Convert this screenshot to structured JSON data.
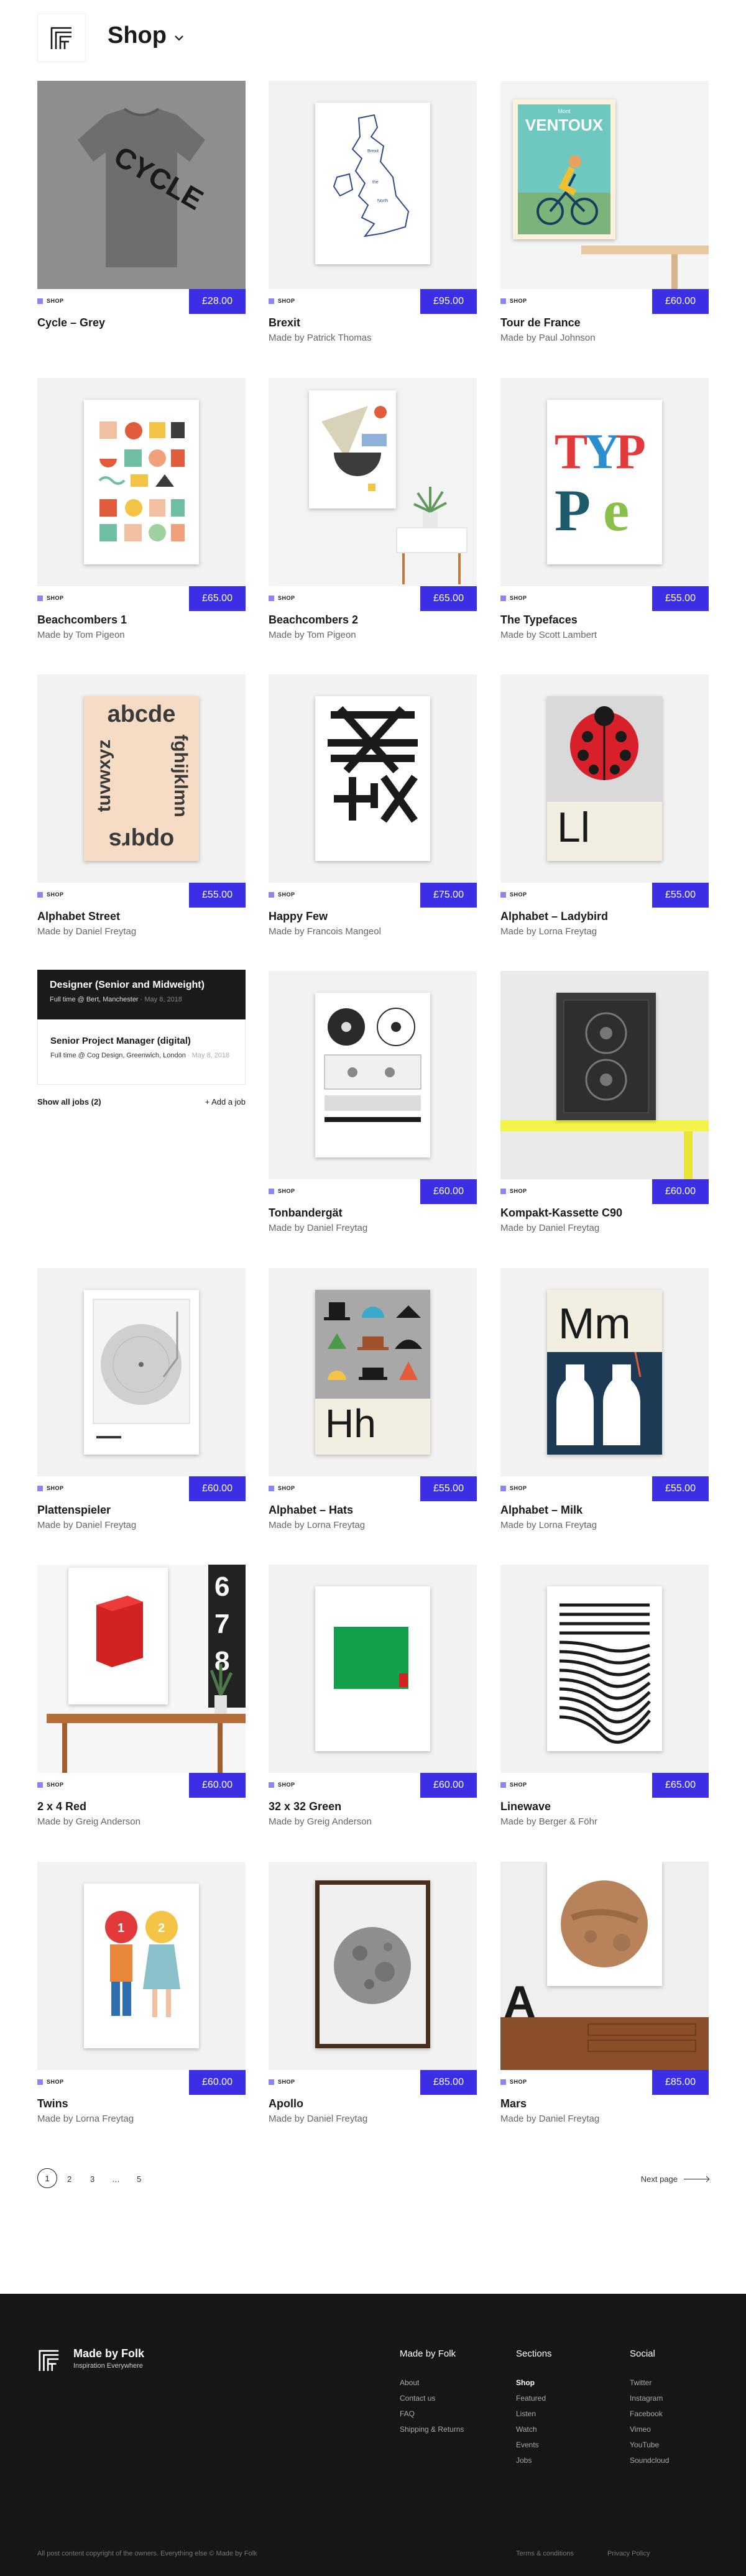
{
  "header": {
    "title": "Shop"
  },
  "products": [
    {
      "tag": "SHOP",
      "price": "£28.00",
      "title": "Cycle – Grey",
      "maker": ""
    },
    {
      "tag": "SHOP",
      "price": "£95.00",
      "title": "Brexit",
      "maker": "Made by Patrick Thomas"
    },
    {
      "tag": "SHOP",
      "price": "£60.00",
      "title": "Tour de France",
      "maker": "Made by Paul Johnson",
      "poster_text": "VENTOUX",
      "poster_top": "Mont"
    },
    {
      "tag": "SHOP",
      "price": "£65.00",
      "title": "Beachcombers 1",
      "maker": "Made by Tom Pigeon"
    },
    {
      "tag": "SHOP",
      "price": "£65.00",
      "title": "Beachcombers 2",
      "maker": "Made by Tom Pigeon"
    },
    {
      "tag": "SHOP",
      "price": "£55.00",
      "title": "The Typefaces",
      "maker": "Made by Scott Lambert"
    },
    {
      "tag": "SHOP",
      "price": "£55.00",
      "title": "Alphabet Street",
      "maker": "Made by Daniel Freytag",
      "poster_top": "abcde",
      "poster_right": "fghijklmn",
      "poster_bottom": "opqrs",
      "poster_left": "tuvwxyz"
    },
    {
      "tag": "SHOP",
      "price": "£75.00",
      "title": "Happy Few",
      "maker": "Made by Francois Mangeol"
    },
    {
      "tag": "SHOP",
      "price": "£55.00",
      "title": "Alphabet – Ladybird",
      "maker": "Made by Lorna Freytag",
      "poster_text": "Ll"
    },
    {
      "tag": "SHOP",
      "price": "£60.00",
      "title": "Tonbandergät",
      "maker": "Made by Daniel Freytag"
    },
    {
      "tag": "SHOP",
      "price": "£60.00",
      "title": "Kompakt-Kassette C90",
      "maker": "Made by Daniel Freytag"
    },
    {
      "tag": "SHOP",
      "price": "£60.00",
      "title": "Plattenspieler",
      "maker": "Made by Daniel Freytag"
    },
    {
      "tag": "SHOP",
      "price": "£55.00",
      "title": "Alphabet – Hats",
      "maker": "Made by Lorna Freytag",
      "poster_text": "Hh"
    },
    {
      "tag": "SHOP",
      "price": "£55.00",
      "title": "Alphabet – Milk",
      "maker": "Made by Lorna Freytag",
      "poster_text": "Mm"
    },
    {
      "tag": "SHOP",
      "price": "£60.00",
      "title": "2 x 4 Red",
      "maker": "Made by Greig Anderson"
    },
    {
      "tag": "SHOP",
      "price": "£60.00",
      "title": "32 x 32 Green",
      "maker": "Made by Greig Anderson"
    },
    {
      "tag": "SHOP",
      "price": "£65.00",
      "title": "Linewave",
      "maker": "Made by Berger & Föhr"
    },
    {
      "tag": "SHOP",
      "price": "£60.00",
      "title": "Twins",
      "maker": "Made by Lorna Freytag"
    },
    {
      "tag": "SHOP",
      "price": "£85.00",
      "title": "Apollo",
      "maker": "Made by Daniel Freytag"
    },
    {
      "tag": "SHOP",
      "price": "£85.00",
      "title": "Mars",
      "maker": "Made by Daniel Freytag"
    }
  ],
  "jobs": {
    "items": [
      {
        "title": "Designer (Senior and Midweight)",
        "meta": "Full time @ Bert, Manchester",
        "date": " · May 8, 2018"
      },
      {
        "title": "Senior Project Manager (digital)",
        "meta": "Full time @ Cog Design, Greenwich, London",
        "date": " · May 8, 2018"
      }
    ],
    "show_all": "Show all jobs (2)",
    "add": "+ Add a job"
  },
  "pagination": {
    "pages": [
      "1",
      "2",
      "3",
      "…",
      "5"
    ],
    "next": "Next page"
  },
  "footer": {
    "brand": "Made by Folk",
    "tagline": "Inspiration Everywhere",
    "columns": [
      {
        "heading": "Made by Folk",
        "links": [
          "About",
          "Contact us",
          "FAQ",
          "Shipping & Returns"
        ]
      },
      {
        "heading": "Sections",
        "links": [
          "Shop",
          "Featured",
          "Listen",
          "Watch",
          "Events",
          "Jobs"
        ]
      },
      {
        "heading": "Social",
        "links": [
          "Twitter",
          "Instagram",
          "Facebook",
          "Vimeo",
          "YouTube",
          "Soundcloud"
        ]
      }
    ],
    "copyright": "All post content copyright of the owners. Everything else © Made by Folk",
    "terms": "Terms & conditions",
    "privacy": "Privacy Policy"
  },
  "colors": {
    "accent": "#3b2ee4",
    "tag_square": "#8b85f0",
    "footer_bg": "#161616"
  }
}
